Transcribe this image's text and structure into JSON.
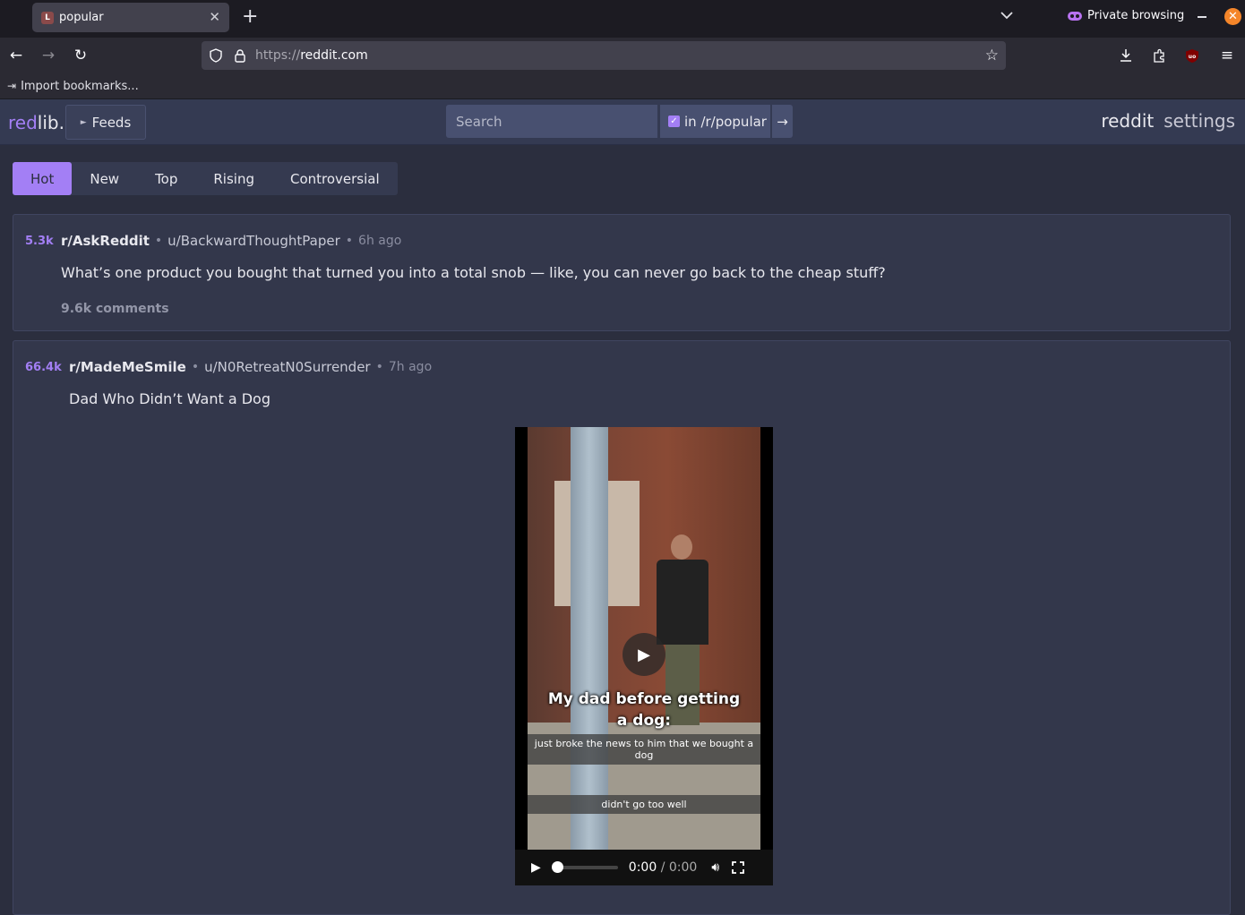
{
  "browser": {
    "tab_title": "popular",
    "tab_favicon_letter": "L",
    "private_label": "Private browsing",
    "url_proto": "https://",
    "url_host": "reddit.com",
    "bookmarks_item": "Import bookmarks..."
  },
  "header": {
    "brand_red": "red",
    "brand_lib": "lib.",
    "feeds_label": "Feeds",
    "search_placeholder": "Search",
    "restrict_label": "in /r/popular",
    "link_reddit": "reddit",
    "link_settings": "settings"
  },
  "sort": [
    "Hot",
    "New",
    "Top",
    "Rising",
    "Controversial"
  ],
  "posts": [
    {
      "score": "5.3k",
      "subreddit": "r/AskReddit",
      "author": "u/BackwardThoughtPaper",
      "time": "6h ago",
      "title": "What’s one product you bought that turned you into a total snob — like, you can never go back to the cheap stuff?",
      "comments": "9.6k comments"
    },
    {
      "score": "66.4k",
      "subreddit": "r/MadeMeSmile",
      "author": "u/N0RetreatN0Surrender",
      "time": "7h ago",
      "title": "Dad Who Didn’t Want a Dog"
    }
  ],
  "video": {
    "caption_main": "My dad before getting a dog:",
    "caption_sub1": "just broke the news to him that we bought a dog",
    "caption_sub2": "didn't go too well",
    "current_time": "0:00",
    "separator": "/",
    "duration": "0:00"
  },
  "colors": {
    "accent": "#a37ff5",
    "background": "#2b2e3e",
    "header_bg": "#343a52"
  }
}
